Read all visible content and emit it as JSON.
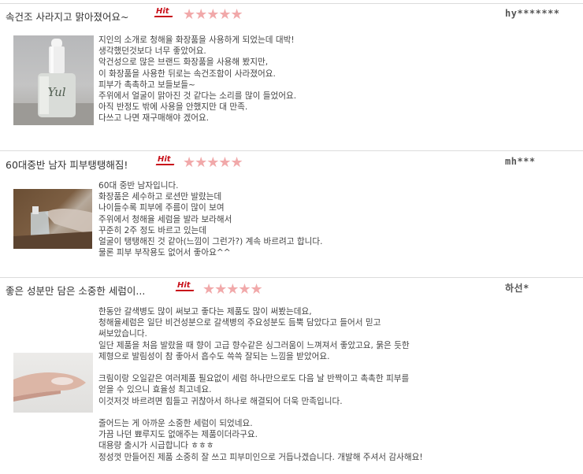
{
  "reviews": [
    {
      "title": "속건조 사라지고 맑아졌어요~",
      "badge": "Hit",
      "rating": 5,
      "stars": "★★★★★",
      "user": "hy*******",
      "body": "지인의 소개로 청해율 화장품을 사용하게 되었는데 대박!\n생각했던것보다 너무 좋았어요.\n악건성으로 많은 브랜드 화장품을 사용해 봤지만,\n이 화장품을 사용한 뒤로는 속건조함이 사라졌어요.\n피부가 촉촉하고 보들보들~\n주위에서 얼굴이 맑아진 것 같다는 소리를 많이 들었어요.\n아직 반정도 밖에 사용을 안했지만 대 만족.\n다쓰고 나면 재구매해야 겠어요.",
      "photo_label": "Yul"
    },
    {
      "title": "60대중반 남자 피부탱탱해짐!",
      "badge": "Hit",
      "rating": 5,
      "stars": "★★★★★",
      "user": "mh***",
      "body": "60대 중반 남자입니다.\n화장품은 세수하고 로션만 발랐는데\n나이들수록 피부에 주름이 많이 보여\n주위에서 청해율 세럼을 발라 보라해서\n꾸준히 2주 정도 바르고 있는데\n얼굴이 탱탱해진 것 같아(느낌이 그런가?) 계속 바르려고 합니다.\n물론 피부 부작용도 없어서 좋아요^^"
    },
    {
      "title": "좋은 성분만 담은 소중한 세럼이...",
      "badge": "Hit",
      "rating": 5,
      "stars": "★★★★★",
      "user": "하선*",
      "body": "한동안 갈색병도 많이 써보고 좋다는 제품도 많이 써봤는데요,\n청해율세럼은 일단 비건성분으로 갈색병의 주요성분도 듬뿍 담았다고 들어서 믿고\n써보았습니다.\n일단 제품을 처음 발랐을 때 향이 고급 향수같은 싱그러움이 느껴져서 좋았고요, 묽은 듯한\n제형으로 발림성이 참 좋아서 흡수도 쓱쓱 잘되는 느낌을 받았어요.\n\n크림이랑 오일같은 여러제품 필요없이 세럼 하나만으로도 다음 날 반짝이고 촉촉한 피부를\n얻을 수 있으니 효율성 최고네요.\n이것저것 바르려면 힘들고 귀찮아서 하나로 해결되어 더욱 만족입니다.\n\n줄어드는 게 아까운 소중한 세럼이 되었네요.\n가끔 나던 뾰루지도 없애주는 제품이더라구요.\n대용량 출시가 시급합니다 ㅎㅎㅎ\n정성껏 만들어진 제품 소중히 잘 쓰고 피부미인으로 거듭나겠습니다. 개발해 주셔서 감사해요!"
    }
  ]
}
